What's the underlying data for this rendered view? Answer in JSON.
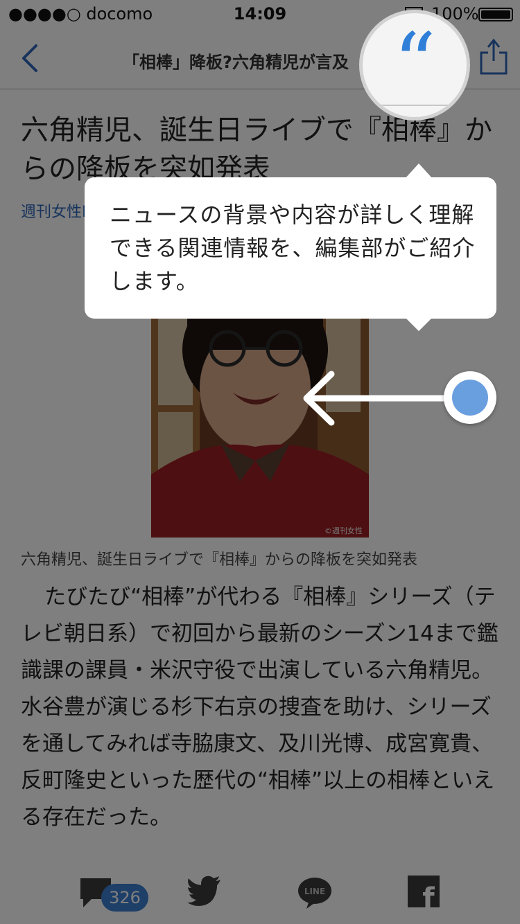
{
  "status_bar": {
    "carrier": "●●●●○ docomo",
    "time": "14:09",
    "battery": "100%"
  },
  "nav": {
    "title": "「相棒」降板?六角精児が言及"
  },
  "article": {
    "headline": "六角精児、誕生日ライブで『相棒』からの降板を突如発表",
    "source": "週刊女性PRIME",
    "photo_credit": "©週刊女性",
    "caption": "六角精児、誕生日ライブで『相棒』からの降板を突如発表",
    "body": "たびたび“相棒”が代わる『相棒』シリーズ（テレビ朝日系）で初回から最新のシーズン14まで鑑識課の課員・米沢守役で出演している六角精児。水谷豊が演じる杉下右京の捜査を助け、シリーズを通してみれば寺脇康文、及川光博、成宮寛貴、反町隆史といった歴代の“相棒”以上の相棒といえる存在だった。"
  },
  "share_bar": {
    "comment_count": "326",
    "line_label": "LINE",
    "facebook_label": "f"
  },
  "tutorial": {
    "quote_mark": "“",
    "tooltip": "ニュースの背景や内容が詳しく理解できる関連情報を、編集部がご紹介します。"
  },
  "colors": {
    "accent": "#2f7fd8",
    "badge": "#3d7fd1",
    "source_link": "#2f66b8",
    "swipe_dot": "#6a9fdf"
  }
}
